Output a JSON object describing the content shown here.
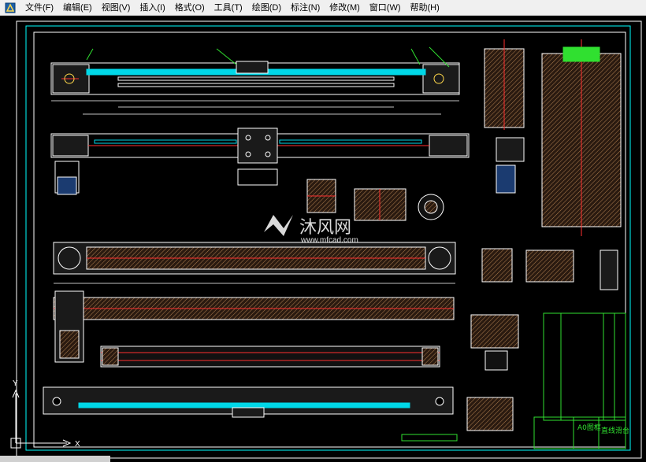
{
  "menubar": {
    "items": [
      {
        "label": "文件(F)"
      },
      {
        "label": "编辑(E)"
      },
      {
        "label": "视图(V)"
      },
      {
        "label": "插入(I)"
      },
      {
        "label": "格式(O)"
      },
      {
        "label": "工具(T)"
      },
      {
        "label": "绘图(D)"
      },
      {
        "label": "标注(N)"
      },
      {
        "label": "修改(M)"
      },
      {
        "label": "窗口(W)"
      },
      {
        "label": "帮助(H)"
      }
    ]
  },
  "watermark": {
    "brand": "沐风网",
    "url": "www.mfcad.com"
  },
  "title_block": {
    "sheet_size": "A0图框",
    "drawing_name": "直线滑台"
  },
  "ucs": {
    "x_label": "X",
    "y_label": "Y"
  },
  "colors": {
    "background": "#000000",
    "frame": "#ffffff",
    "inner_frame": "#00ffff",
    "outline": "#ffffff",
    "cut_fill": "#00d8e8",
    "center": "#ff3030",
    "leader": "#30e030",
    "table": "#30e030",
    "hatch": "#b08050",
    "dimension": "#c0c0c0"
  },
  "icons": {
    "app": "autocad-app-icon",
    "ucs": "ucs-axis-icon"
  }
}
